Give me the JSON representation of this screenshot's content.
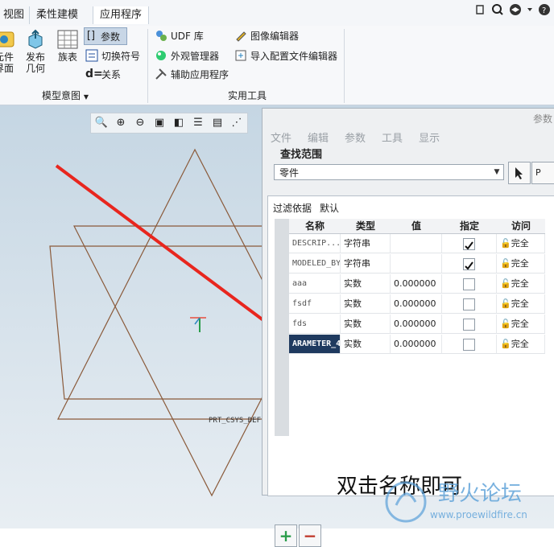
{
  "ribbon": {
    "tabs": [
      "视图",
      "柔性建模",
      "应用程序"
    ],
    "model_group": {
      "label": "模型意图",
      "buttons": [
        "元件\n界面",
        "发布\n几何",
        "族表"
      ],
      "items": [
        "参数",
        "切换符号",
        "关系"
      ]
    },
    "tools_group": {
      "label": "实用工具",
      "items": [
        "UDF 库",
        "外观管理器",
        "辅助应用程序",
        "图像编辑器",
        "导入配置文件编辑器"
      ]
    },
    "top_right_icons": [
      "help-icon",
      "search-icon",
      "graduation-cap-icon",
      "dropdown-icon",
      "help-question-icon"
    ]
  },
  "viewport": {
    "csys_label": "PRT_CSYS_DEF",
    "toolbar_icons": [
      "refit-icon",
      "zoom-in-icon",
      "zoom-out-icon",
      "repaint-icon",
      "display-style-icon",
      "annotations-icon",
      "saved-views-icon",
      "datum-display-icon"
    ]
  },
  "dialog": {
    "title": "参数",
    "menus": [
      "文件",
      "编辑",
      "参数",
      "工具",
      "显示"
    ],
    "lookin_label": "查找范围",
    "lookin_value": "零件",
    "p_button": "P",
    "filter_label": "过滤依据",
    "filter_value": "默认",
    "columns": [
      "名称",
      "类型",
      "值",
      "指定",
      "访问"
    ],
    "rows": [
      {
        "name": "DESCRIP...",
        "type": "字符串",
        "value": "",
        "designated": true,
        "access": "完全"
      },
      {
        "name": "MODELED_BY",
        "type": "字符串",
        "value": "",
        "designated": true,
        "access": "完全"
      },
      {
        "name": "aaa",
        "type": "实数",
        "value": "0.000000",
        "designated": false,
        "access": "完全"
      },
      {
        "name": "fsdf",
        "type": "实数",
        "value": "0.000000",
        "designated": false,
        "access": "完全"
      },
      {
        "name": "fds",
        "type": "实数",
        "value": "0.000000",
        "designated": false,
        "access": "完全"
      },
      {
        "name": "ARAMETER_4",
        "type": "实数",
        "value": "0.000000",
        "designated": false,
        "access": "完全"
      }
    ],
    "note": "双击名称即可",
    "add_label": "+",
    "remove_label": "−"
  },
  "watermark": {
    "title": "野火论坛",
    "url": "www.proewildfire.cn"
  },
  "colors": {
    "arrow": "#e8261e",
    "geometry": "#8a5a3a",
    "watermark": "#5aa0d8"
  }
}
